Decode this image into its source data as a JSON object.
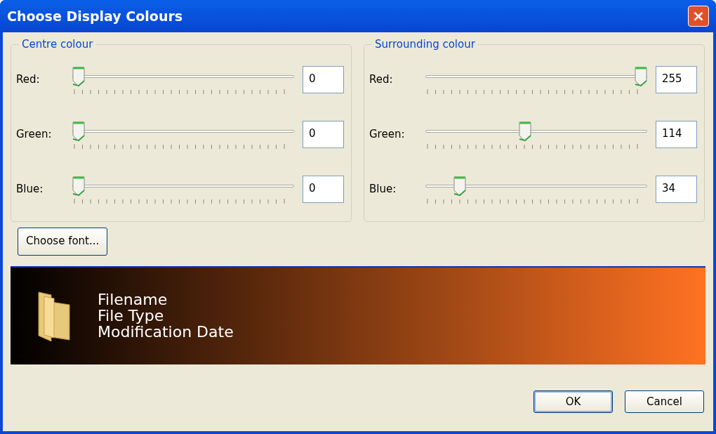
{
  "window": {
    "title": "Choose Display Colours",
    "close_label": "×"
  },
  "groups": [
    {
      "title": "Centre colour",
      "sliders": [
        {
          "label": "Red:",
          "level": 0,
          "value": "0"
        },
        {
          "label": "Green:",
          "level": 0,
          "value": "0"
        },
        {
          "label": "Blue:",
          "level": 0,
          "value": "0"
        }
      ]
    },
    {
      "title": "Surrounding colour",
      "sliders": [
        {
          "label": "Red:",
          "level": 1,
          "value": "255"
        },
        {
          "label": "Green:",
          "level": 0.447,
          "value": "114"
        },
        {
          "label": "Blue:",
          "level": 0.133,
          "value": "34"
        }
      ]
    }
  ],
  "font_button": "Choose font...",
  "preview": {
    "lines": [
      "Filename",
      "File Type",
      "Modification Date"
    ]
  },
  "buttons": [
    {
      "label": "OK",
      "default": true
    },
    {
      "label": "Cancel",
      "default": false
    }
  ]
}
